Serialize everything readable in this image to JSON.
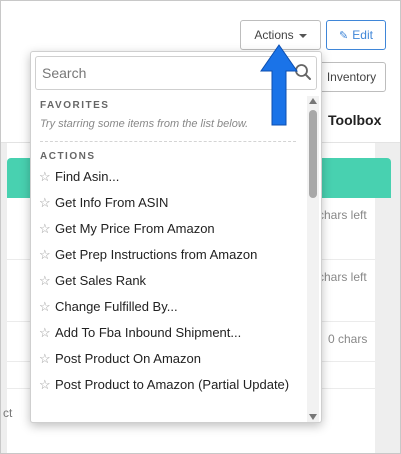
{
  "toolbar": {
    "actions_label": "Actions",
    "edit_label": "Edit",
    "inventory_label": "Inventory"
  },
  "tabs": {
    "toolbox_label": "Toolbox"
  },
  "background": {
    "hints": [
      "chars left",
      "chars left",
      "0 chars"
    ],
    "fragment": "ct"
  },
  "dropdown": {
    "search": {
      "placeholder": "Search",
      "value": ""
    },
    "favorites": {
      "title": "FAVORITES",
      "empty_text": "Try starring some items from the list below."
    },
    "actions": {
      "title": "ACTIONS",
      "items": [
        {
          "label": "Find Asin..."
        },
        {
          "label": "Get Info From ASIN"
        },
        {
          "label": "Get My Price From Amazon"
        },
        {
          "label": "Get Prep Instructions from Amazon"
        },
        {
          "label": "Get Sales Rank"
        },
        {
          "label": "Change Fulfilled By..."
        },
        {
          "label": "Add To Fba Inbound Shipment..."
        },
        {
          "label": "Post Product On Amazon"
        },
        {
          "label": "Post Product to Amazon (Partial Update)"
        }
      ]
    }
  },
  "icons": {
    "caret": "caret-down-icon",
    "pencil": "pencil-icon",
    "search": "search-icon",
    "star": "star-outline-icon",
    "arrow": "arrow-up-icon"
  },
  "colors": {
    "accent_blue": "#3f86d8",
    "teal": "#48d1b0",
    "annotation_arrow": "#1a73e8"
  }
}
